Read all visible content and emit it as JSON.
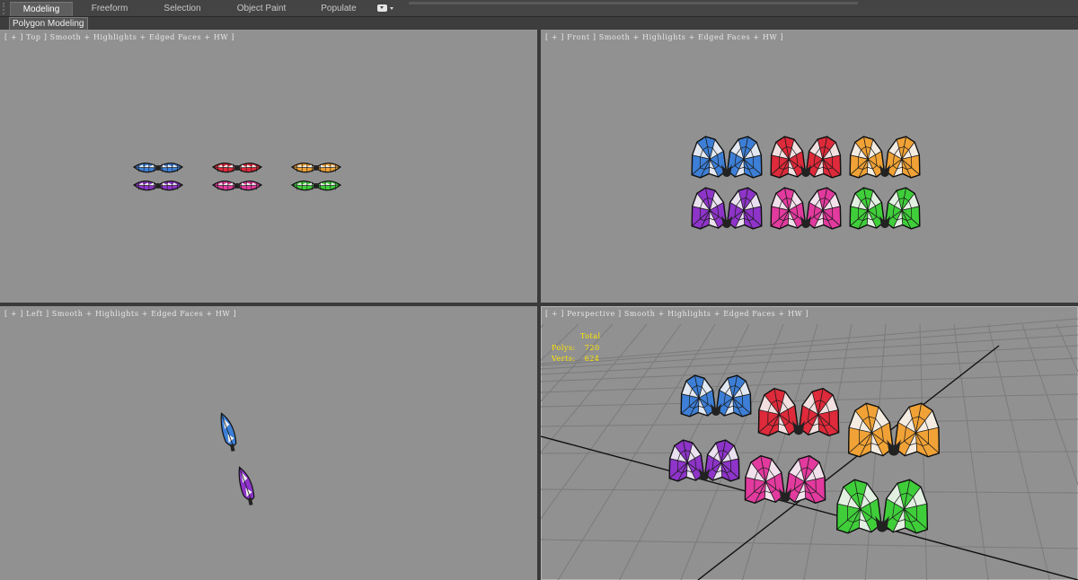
{
  "ribbon": {
    "tabs": [
      {
        "label": "Modeling",
        "active": true
      },
      {
        "label": "Freeform",
        "active": false
      },
      {
        "label": "Selection",
        "active": false
      },
      {
        "label": "Object Paint",
        "active": false
      },
      {
        "label": "Populate",
        "active": false
      }
    ],
    "subtab": "Polygon Modeling"
  },
  "viewports": {
    "top": {
      "label": "[ + ] Top ] Smooth + Highlights + Edged Faces + HW ]"
    },
    "front": {
      "label": "[ + ] Front ] Smooth + Highlights + Edged Faces + HW ]"
    },
    "left": {
      "label": "[ + ] Left ] Smooth + Highlights + Edged Faces + HW ]"
    },
    "perspective": {
      "label": "[ + ] Perspective ] Smooth + Highlights + Edged Faces + HW ]"
    }
  },
  "stats": {
    "header": "Total",
    "polys_label": "Polys:",
    "polys_value": "720",
    "verts_label": "Verts:",
    "verts_value": "624"
  },
  "bow_colors": {
    "blue": "#3d7fd6",
    "red": "#de2a3a",
    "orange": "#f0a236",
    "purple": "#8e34c9",
    "pink": "#e23a9e",
    "green": "#3fce3a"
  },
  "colors": {
    "viewport_bg": "#919191",
    "ui_bg": "#444444",
    "stats_text": "#ffe600"
  }
}
